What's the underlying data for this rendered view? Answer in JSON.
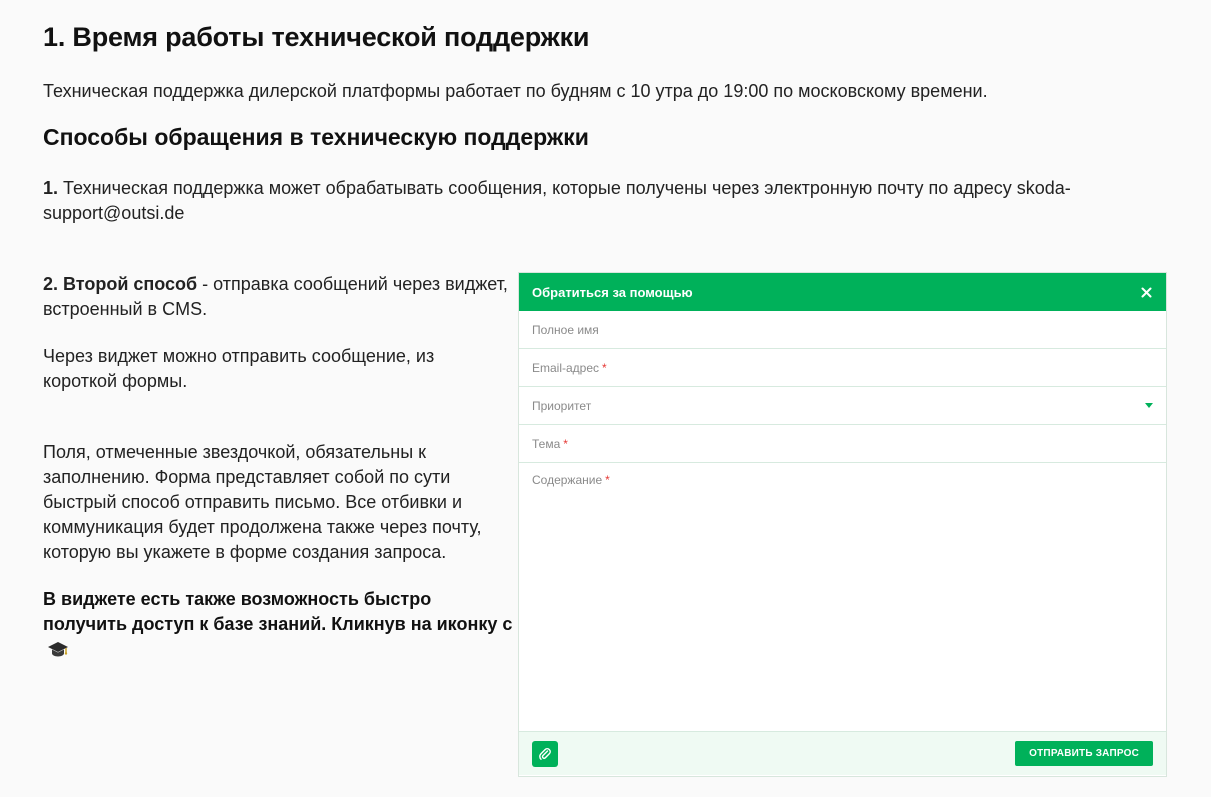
{
  "section": {
    "title": "1. Время работы технической поддержки",
    "intro": "Техническая поддержка дилерской платформы работает по будням с 10 утра до 19:00 по московскому времени."
  },
  "contact": {
    "title": "Способы обращения в техническую поддержки",
    "method1_num": "1.",
    "method1_text": " Техническая поддержка может обрабатывать сообщения, которые получены через электронную почту по адресу skoda-support@outsi.de",
    "method2_label": "2. Второй способ",
    "method2_text": " - отправка сообщений через виджет, встроенный в CMS.",
    "p2": "Через виджет можно отправить сообщение, из короткой формы.",
    "p3": "Поля, отмеченные звездочкой, обязательны к заполнению. Форма представляет собой по сути быстрый способ отправить письмо. Все отбивки и коммуникация будет продолжена также через почту, которую вы укажете в форме создания запроса.",
    "p4": "В виджете есть также возможность быстро получить доступ к базе знаний. Кликнув на иконку с"
  },
  "widget": {
    "title": "Обратиться за помощью",
    "close_icon": "close-icon",
    "fields": {
      "fullname": "Полное имя",
      "email": "Email-адрес",
      "priority": "Приоритет",
      "subject": "Тема",
      "content": "Содержание"
    },
    "required_mark": "*",
    "attach_icon": "paperclip-icon",
    "submit_label": "ОТПРАВИТЬ ЗАПРОС"
  },
  "colors": {
    "accent": "#00b15a",
    "footer_bg": "#effaf3",
    "required": "#e53935"
  }
}
